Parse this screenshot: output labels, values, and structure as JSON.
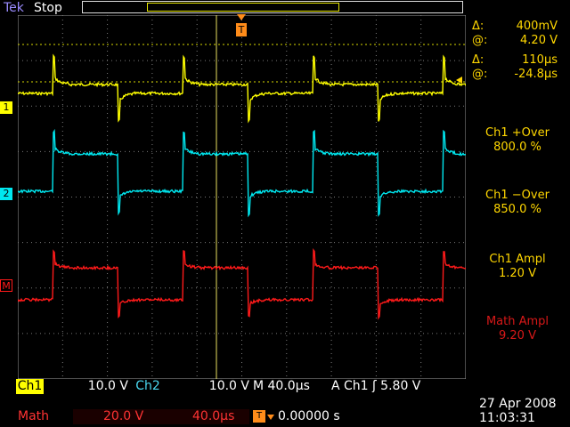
{
  "header": {
    "brand_prefix": "Tek",
    "brand_suffix": "",
    "acq_state": "Stop",
    "trigger_marker": "T"
  },
  "channels": {
    "ch1_marker": "1",
    "ch2_marker": "2",
    "math_marker": "M"
  },
  "measurements": {
    "delta_v_symbol": "Δ:",
    "delta_v": "400mV",
    "at_v_symbol": "@:",
    "at_v": "4.20 V",
    "delta_t_symbol": "Δ:",
    "delta_t": "110µs",
    "at_t_symbol": "@:",
    "at_t": "-24.8µs",
    "m1_label": "Ch1 +Over",
    "m1_value": "800.0 %",
    "m2_label": "Ch1 −Over",
    "m2_value": "850.0 %",
    "m3_label": "Ch1 Ampl",
    "m3_value": "1.20 V",
    "m4_label": "Math Ampl",
    "m4_value": "9.20 V"
  },
  "status": {
    "ch1_label": "Ch1",
    "ch1_scale": "10.0 V",
    "ch2_label": "Ch2",
    "ch2_scale": "10.0 V",
    "timebase": "M 40.0µs",
    "trigger": "A  Ch1  ʃ  5.80 V",
    "math_label": "Math",
    "math_scale": "20.0 V",
    "math_time": "40.0µs",
    "trigger_position": "0.00000 s",
    "date": "27 Apr 2008",
    "time": "11:03:31"
  },
  "colors": {
    "ch1": "#ffff00",
    "ch2": "#00e8f0",
    "math": "#ff1a1a",
    "measure": "#ffd700"
  }
}
